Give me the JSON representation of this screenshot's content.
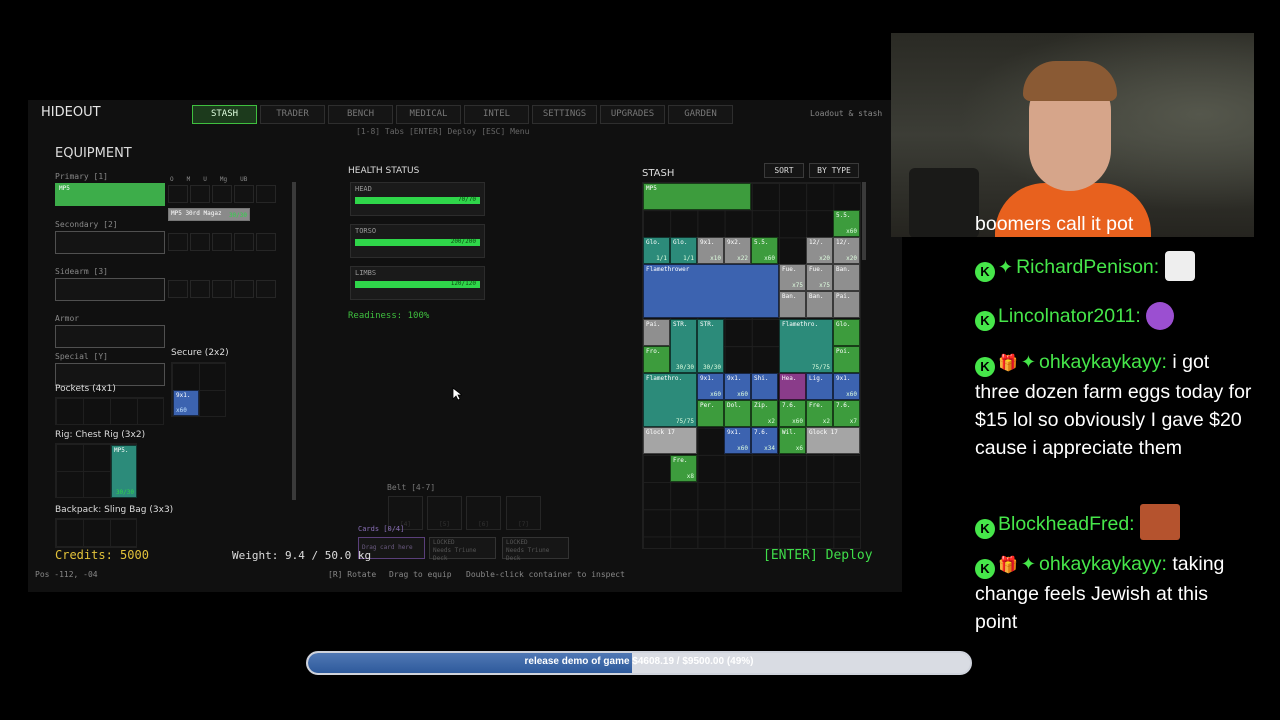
{
  "hud": {
    "title": "HIDEOUT",
    "top_right_hint": "Loadout & stash",
    "sub_hint": "[1-8] Tabs  [ENTER] Deploy  [ESC] Menu",
    "tabs": [
      "STASH",
      "TRADER",
      "BENCH",
      "MEDICAL",
      "INTEL",
      "SETTINGS",
      "UPGRADES",
      "GARDEN"
    ]
  },
  "equipment": {
    "heading": "EQUIPMENT",
    "primary_label": "Primary [1]",
    "primary_item": "MP5",
    "mod_labels": [
      "O",
      "M",
      "U",
      "Mg",
      "UB"
    ],
    "mag_item": "MP5 30rd Magaz",
    "mag_count": "30/30",
    "secondary_label": "Secondary [2]",
    "sidearm_label": "Sidearm [3]",
    "armor_label": "Armor",
    "special_label": "Special [Y]",
    "secure_label": "Secure (2x2)",
    "secure_item": "9x1.",
    "secure_count": "x60",
    "pockets_label": "Pockets (4x1)",
    "rig_label": "Rig: Chest Rig (3x2)",
    "rig_item": "MP5.",
    "rig_count": "30/30",
    "backpack_label": "Backpack: Sling Bag (3x3)"
  },
  "health": {
    "heading": "HEALTH STATUS",
    "parts": [
      {
        "name": "HEAD",
        "value": "70/70"
      },
      {
        "name": "TORSO",
        "value": "200/200"
      },
      {
        "name": "LIMBS",
        "value": "120/120"
      }
    ],
    "readiness": "Readiness: 100%"
  },
  "stash": {
    "heading": "STASH",
    "sort_btn": "SORT",
    "bytype_btn": "BY TYPE"
  },
  "belt": {
    "label": "Belt [4-7]",
    "slots": [
      "[4]",
      "[5]",
      "[6]",
      "[7]"
    ]
  },
  "cards": {
    "label": "Cards [0/4]",
    "drag": "Drag card here",
    "locked": "LOCKED",
    "locked_sub": "Needs Triune Deck"
  },
  "footer": {
    "credits": "Credits: 5000",
    "weight": "Weight: 9.4 / 50.0 kg",
    "hint_rotate": "[R] Rotate",
    "hint_drag": "Drag to equip",
    "hint_inspect": "Double-click container to inspect",
    "deploy": "[ENTER] Deploy",
    "pos": "Pos -112, -04"
  },
  "chat": {
    "messages": [
      {
        "user": "",
        "text": "boomers call it pot"
      },
      {
        "user": "RichardPenison:",
        "text": ""
      },
      {
        "user": "Lincolnator2011:",
        "text": ""
      },
      {
        "user": "ohkaykaykayy:",
        "text": "i got three dozen farm eggs today for $15 lol so obviously I gave $20 cause i appreciate them"
      },
      {
        "user": "BlockheadFred:",
        "text": ""
      },
      {
        "user": "ohkaykaykayy:",
        "text": "taking change feels Jewish at this point"
      }
    ]
  },
  "goal": {
    "text": "release demo of game $4608.19 / $9500.00 (49%)",
    "progress": 0.49
  },
  "colors": {
    "accent_green": "#3fbf3f",
    "chat_name": "#46e64a"
  }
}
